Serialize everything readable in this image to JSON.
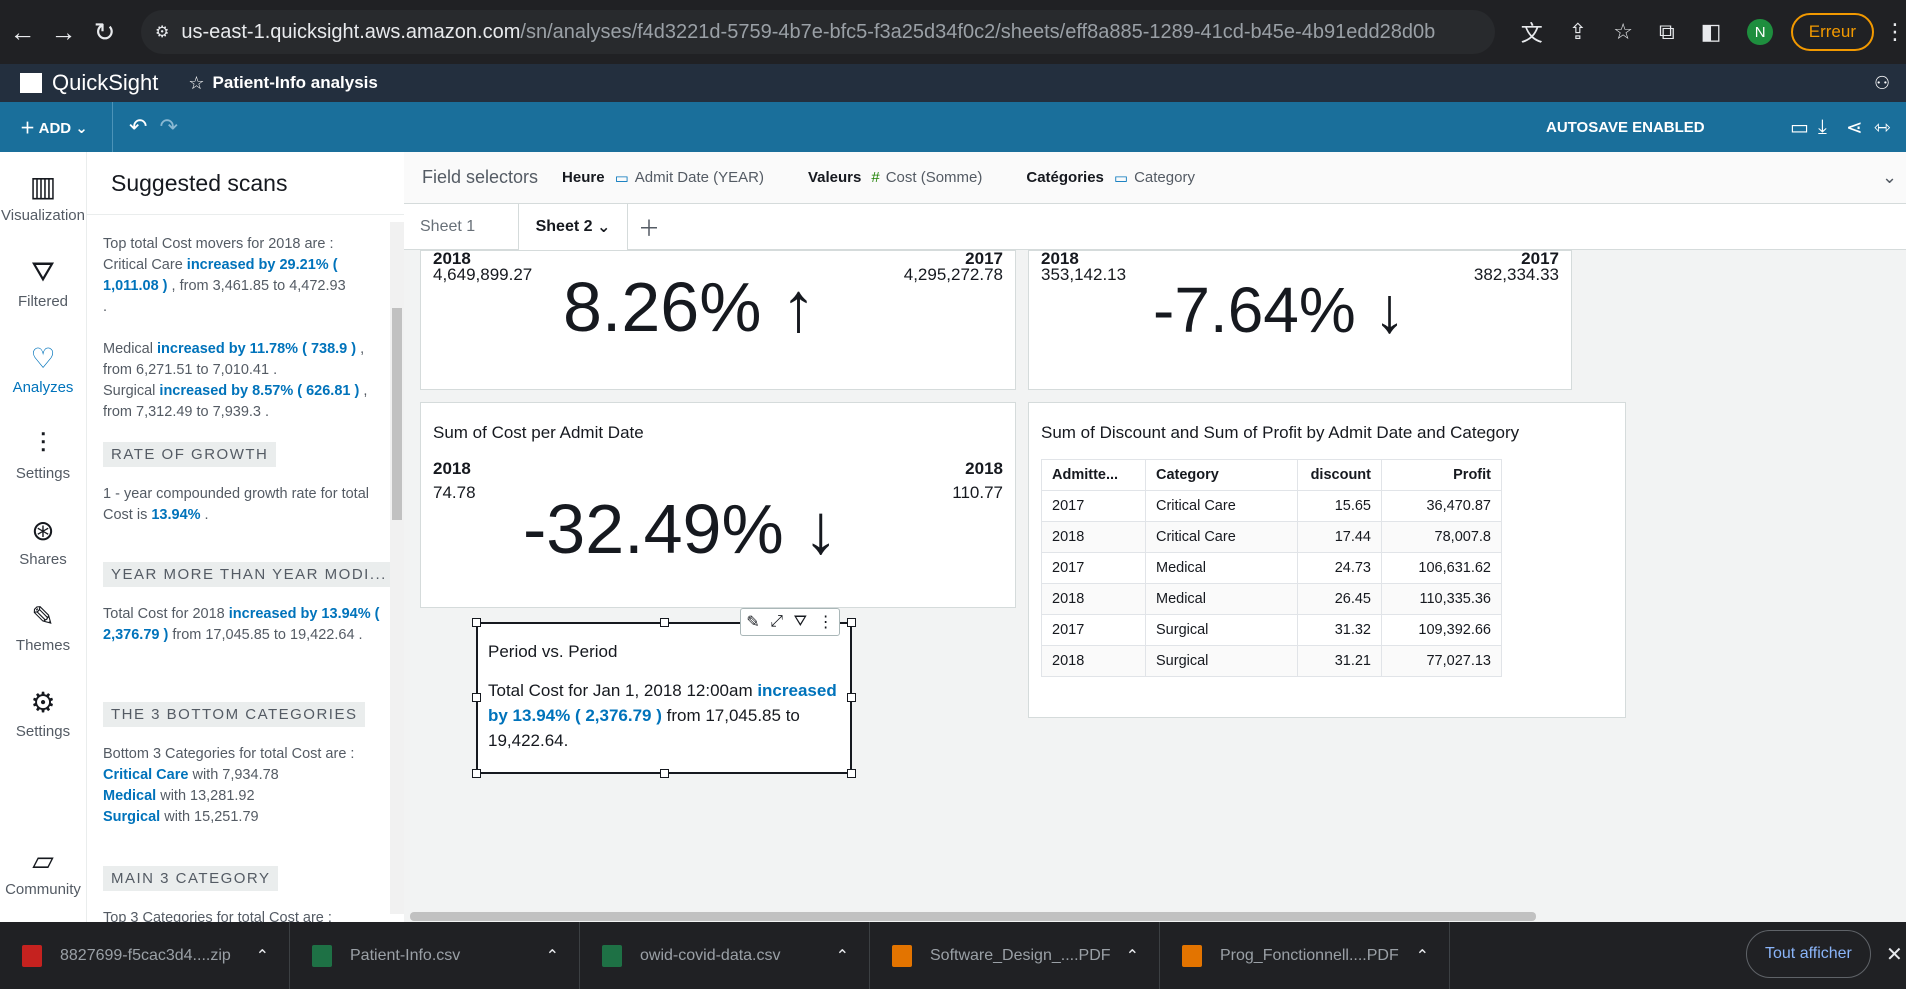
{
  "browser": {
    "url_host": "us-east-1.quicksight.aws.amazon.com",
    "url_path": "/sn/analyses/f4d3221d-5759-4b7e-bfc5-f3a25d34f0c2/sheets/eff8a885-1289-41cd-b45e-4b91edd28d0b",
    "profile_initial": "N",
    "error_label": "Erreur"
  },
  "header": {
    "app_title": "QuickSight",
    "analysis_title": "Patient-Info analysis"
  },
  "toolbar": {
    "add_label": "ADD",
    "autosave": "AUTOSAVE ENABLED"
  },
  "leftnav": {
    "items": [
      {
        "label": "Visualization"
      },
      {
        "label": "Filtered"
      },
      {
        "label": "Analyzes"
      },
      {
        "label": "Settings"
      },
      {
        "label": "Shares"
      },
      {
        "label": "Themes"
      },
      {
        "label": "Settings"
      },
      {
        "label": "Community"
      }
    ]
  },
  "panel": {
    "title": "Suggested scans",
    "movers": {
      "intro": "Top total Cost movers for 2018 are :",
      "l1a": "Critical Care ",
      "l1b": "increased by 29.21% ( 1,011.08 )",
      "l1c": " , from 3,461.85 to 4,472.93",
      "l2a": "Medical ",
      "l2b": "increased by 11.78% ( 738.9 )",
      "l2c": " , from 6,271.51 to 7,010.41 .",
      "l3a": "Surgical ",
      "l3b": "increased by 8.57% ( 626.81 )",
      "l3c": " , from 7,312.49 to 7,939.3 ."
    },
    "growth": {
      "head": "RATE OF GROWTH",
      "t1": "1 - year compounded growth rate for total Cost is ",
      "t2": "13.94%",
      "t3": " ."
    },
    "yoy": {
      "head": "YEAR MORE THAN YEAR MODI...",
      "t1": "Total Cost for 2018 ",
      "t2": "increased by 13.94% ( 2,376.79 )",
      "t3": " from 17,045.85 to 19,422.64 ."
    },
    "bottom3": {
      "head": "THE 3 BOTTOM CATEGORIES",
      "intro": "Bottom 3 Categories for total Cost are :",
      "c1": "Critical Care",
      "v1": " with 7,934.78",
      "c2": "Medical",
      "v2": " with 13,281.92",
      "c3": "Surgical",
      "v3": " with 15,251.79"
    },
    "main3": {
      "head": "MAIN 3 CATEGORY",
      "intro": "Top 3 Categories for total Cost are :"
    }
  },
  "field_selectors": {
    "label": "Field selectors",
    "heure_label": "Heure",
    "heure_value": "Admit Date (YEAR)",
    "valeurs_label": "Valeurs",
    "valeurs_value": "Cost (Somme)",
    "categories_label": "Catégories",
    "categories_value": "Category"
  },
  "sheets": {
    "tab1": "Sheet 1",
    "tab2": "Sheet 2"
  },
  "kpi1": {
    "left_label": "2018",
    "left_value": "4,649,899.27",
    "right_label": "2017",
    "right_value": "4,295,272.78",
    "change": "8.26%",
    "arrow": "↑"
  },
  "kpi2": {
    "left_label": "2018",
    "left_value": "353,142.13",
    "right_label": "2017",
    "right_value": "382,334.33",
    "change": "-7.64%",
    "arrow": "↓"
  },
  "kpi3": {
    "title": "Sum of Cost per Admit Date",
    "left_label": "2018",
    "left_value": "74.78",
    "right_label": "2018",
    "right_value": "110.77",
    "change": "-32.49%",
    "arrow": "↓"
  },
  "table_card": {
    "title": "Sum of Discount and Sum of Profit by Admit Date and Category",
    "headers": [
      "Admitte...",
      "Category",
      "discount",
      "Profit"
    ],
    "rows": [
      [
        "2017",
        "Critical Care",
        "15.65",
        "36,470.87"
      ],
      [
        "2018",
        "Critical Care",
        "17.44",
        "78,007.8"
      ],
      [
        "2017",
        "Medical",
        "24.73",
        "106,631.62"
      ],
      [
        "2018",
        "Medical",
        "26.45",
        "110,335.36"
      ],
      [
        "2017",
        "Surgical",
        "31.32",
        "109,392.66"
      ],
      [
        "2018",
        "Surgical",
        "31.21",
        "77,027.13"
      ]
    ]
  },
  "pvp": {
    "title": "Period vs. Period",
    "t1": "Total Cost for Jan 1, 2018 12:00am ",
    "t2": "increased by 13.94% ( 2,376.79 )",
    "t3": " from 17,045.85 to 19,422.64."
  },
  "downloads": {
    "items": [
      {
        "name": "8827699-f5cac3d4....zip",
        "color": "#c5221f"
      },
      {
        "name": "Patient-Info.csv",
        "color": "#1e7145"
      },
      {
        "name": "owid-covid-data.csv",
        "color": "#1e7145"
      },
      {
        "name": "Software_Design_....PDF",
        "color": "#e37400"
      },
      {
        "name": "Prog_Fonctionnell....PDF",
        "color": "#e37400"
      }
    ],
    "show_all": "Tout afficher"
  }
}
